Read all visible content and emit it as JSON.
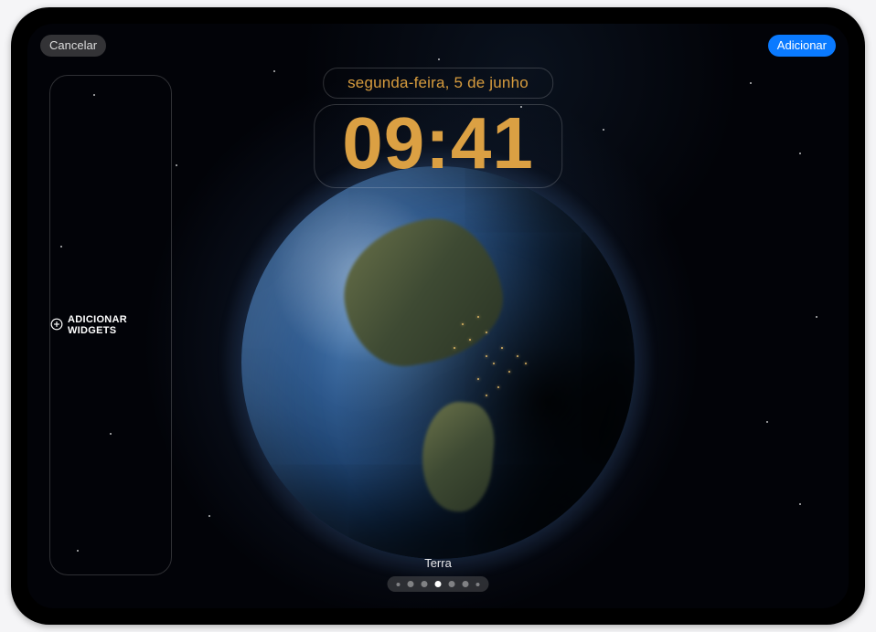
{
  "topbar": {
    "cancel_label": "Cancelar",
    "add_label": "Adicionar"
  },
  "lockscreen": {
    "date": "segunda-feira, 5 de junho",
    "time": "09:41"
  },
  "widgets": {
    "add_label": "ADICIONAR WIDGETS"
  },
  "wallpaper": {
    "name": "Terra"
  },
  "pager": {
    "total": 7,
    "active_index": 3
  },
  "colors": {
    "accent": "#0a7aff",
    "time_color": "#dba043"
  }
}
